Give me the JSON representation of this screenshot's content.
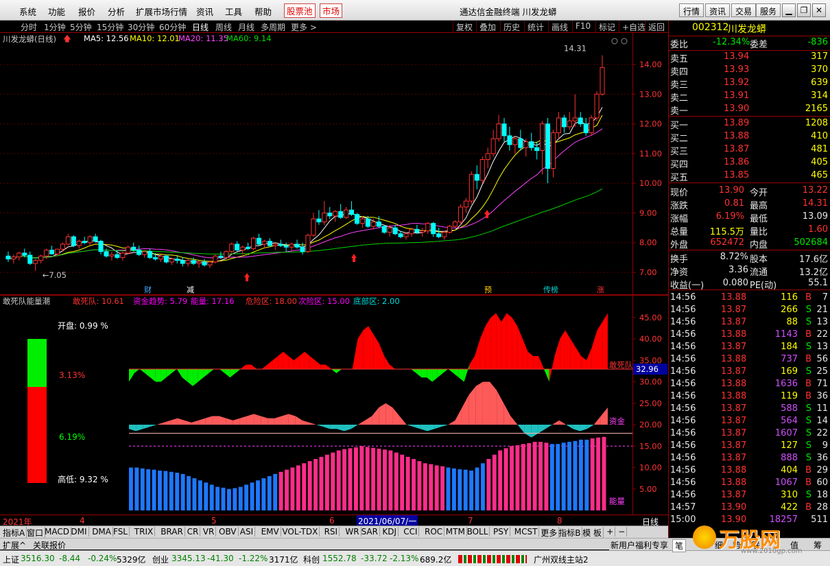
{
  "menubar": {
    "items": [
      "系统",
      "功能",
      "报价",
      "分析",
      "扩展市场行情",
      "资讯",
      "工具",
      "帮助"
    ],
    "highlight": [
      "股票池",
      "市场"
    ],
    "title": "通达信金融终端  川发龙蟒",
    "buttons": [
      "行情",
      "资讯",
      "交易",
      "服务"
    ]
  },
  "periods": [
    "分时",
    "1分钟",
    "5分钟",
    "15分钟",
    "30分钟",
    "60分钟",
    "日线",
    "周线",
    "月线",
    "多周期",
    "更多 >"
  ],
  "tools": [
    "复权",
    "叠加",
    "历史",
    "统计",
    "画线",
    "F10",
    "标记",
    "+自选",
    "返回"
  ],
  "chartinfo": {
    "name": "川发龙蟒(日线)",
    "ma5": "MA5: 12.56",
    "ma10": "MA10: 12.01",
    "ma20": "MA20: 11.35",
    "ma60": "MA60: 9.14"
  },
  "chart_data": {
    "type": "candlestick",
    "y_ticks": [
      "14.00",
      "13.00",
      "12.00",
      "11.00",
      "10.00",
      "9.00",
      "8.00",
      "7.00"
    ],
    "ylim": [
      6.7,
      14.6
    ],
    "annotations": {
      "high": "14.31",
      "low": "7.05"
    },
    "candles": [
      [
        7.55,
        7.7,
        7.35,
        7.45
      ],
      [
        7.45,
        7.6,
        7.3,
        7.52
      ],
      [
        7.52,
        7.7,
        7.4,
        7.65
      ],
      [
        7.65,
        7.8,
        7.5,
        7.58
      ],
      [
        7.58,
        7.7,
        7.25,
        7.3
      ],
      [
        7.3,
        7.45,
        7.05,
        7.4
      ],
      [
        7.4,
        7.6,
        7.3,
        7.55
      ],
      [
        7.55,
        7.8,
        7.45,
        7.75
      ],
      [
        7.75,
        7.9,
        7.6,
        7.62
      ],
      [
        7.62,
        7.8,
        7.55,
        7.78
      ],
      [
        7.78,
        8.0,
        7.7,
        7.95
      ],
      [
        7.95,
        8.3,
        7.9,
        8.2
      ],
      [
        8.2,
        8.25,
        7.85,
        7.9
      ],
      [
        7.9,
        8.1,
        7.8,
        8.05
      ],
      [
        8.05,
        8.2,
        7.95,
        8.0
      ],
      [
        8.0,
        8.25,
        7.9,
        8.2
      ],
      [
        8.2,
        8.3,
        8.0,
        8.05
      ],
      [
        8.05,
        8.1,
        7.6,
        7.7
      ],
      [
        7.7,
        7.8,
        7.5,
        7.55
      ],
      [
        7.55,
        7.7,
        7.4,
        7.6
      ],
      [
        7.6,
        7.75,
        7.45,
        7.5
      ],
      [
        7.5,
        7.7,
        7.4,
        7.65
      ],
      [
        7.65,
        7.9,
        7.6,
        7.85
      ],
      [
        7.85,
        8.0,
        7.7,
        7.75
      ],
      [
        7.75,
        7.9,
        7.55,
        7.6
      ],
      [
        7.6,
        7.75,
        7.5,
        7.7
      ],
      [
        7.7,
        7.8,
        7.45,
        7.5
      ],
      [
        7.5,
        7.65,
        7.4,
        7.45
      ],
      [
        7.45,
        7.6,
        7.35,
        7.55
      ],
      [
        7.55,
        7.6,
        7.3,
        7.35
      ],
      [
        7.35,
        7.5,
        7.25,
        7.45
      ],
      [
        7.45,
        7.55,
        7.3,
        7.4
      ],
      [
        7.4,
        7.5,
        7.2,
        7.3
      ],
      [
        7.3,
        7.45,
        7.2,
        7.4
      ],
      [
        7.4,
        7.5,
        7.25,
        7.3
      ],
      [
        7.3,
        7.4,
        7.15,
        7.35
      ],
      [
        7.35,
        7.45,
        7.2,
        7.25
      ],
      [
        7.25,
        7.4,
        7.15,
        7.35
      ],
      [
        7.35,
        7.6,
        7.3,
        7.55
      ],
      [
        7.55,
        7.7,
        7.45,
        7.5
      ],
      [
        7.5,
        7.75,
        7.45,
        7.7
      ],
      [
        7.7,
        8.0,
        7.65,
        7.95
      ],
      [
        7.95,
        8.05,
        7.7,
        7.75
      ],
      [
        7.75,
        7.9,
        7.6,
        7.85
      ],
      [
        7.85,
        8.0,
        7.75,
        7.8
      ],
      [
        7.8,
        8.2,
        7.75,
        8.15
      ],
      [
        8.15,
        8.3,
        7.9,
        7.95
      ],
      [
        7.95,
        8.1,
        7.8,
        8.05
      ],
      [
        8.05,
        8.15,
        7.85,
        7.9
      ],
      [
        7.9,
        8.0,
        7.75,
        7.95
      ],
      [
        7.95,
        8.1,
        7.85,
        7.9
      ],
      [
        7.9,
        8.0,
        7.7,
        7.85
      ],
      [
        7.85,
        8.0,
        7.75,
        7.95
      ],
      [
        7.95,
        8.1,
        7.8,
        7.85
      ],
      [
        7.85,
        8.0,
        7.6,
        7.7
      ],
      [
        7.7,
        8.3,
        7.65,
        8.25
      ],
      [
        8.25,
        9.0,
        8.2,
        8.8
      ],
      [
        8.8,
        9.1,
        8.6,
        8.7
      ],
      [
        8.7,
        9.4,
        8.6,
        9.0
      ],
      [
        9.0,
        9.2,
        8.8,
        8.9
      ],
      [
        8.9,
        9.1,
        8.7,
        9.05
      ],
      [
        9.05,
        9.3,
        8.8,
        8.85
      ],
      [
        8.85,
        9.2,
        8.8,
        9.1
      ],
      [
        9.1,
        9.4,
        8.9,
        8.95
      ],
      [
        8.95,
        9.0,
        8.6,
        8.65
      ],
      [
        8.65,
        8.9,
        8.5,
        8.8
      ],
      [
        8.8,
        8.9,
        8.5,
        8.55
      ],
      [
        8.55,
        8.8,
        8.45,
        8.7
      ],
      [
        8.7,
        8.9,
        8.5,
        8.55
      ],
      [
        8.55,
        8.6,
        8.3,
        8.35
      ],
      [
        8.35,
        8.6,
        8.2,
        8.5
      ],
      [
        8.5,
        8.6,
        8.25,
        8.3
      ],
      [
        8.3,
        8.4,
        8.15,
        8.2
      ],
      [
        8.2,
        8.35,
        8.1,
        8.3
      ],
      [
        8.3,
        8.5,
        8.2,
        8.45
      ],
      [
        8.45,
        8.6,
        8.3,
        8.35
      ],
      [
        8.35,
        8.5,
        8.2,
        8.4
      ],
      [
        8.4,
        8.7,
        8.3,
        8.65
      ],
      [
        8.65,
        8.7,
        8.2,
        8.3
      ],
      [
        8.3,
        8.5,
        8.15,
        8.2
      ],
      [
        8.2,
        8.4,
        8.1,
        8.35
      ],
      [
        8.35,
        8.6,
        8.3,
        8.55
      ],
      [
        8.55,
        8.75,
        8.5,
        8.7
      ],
      [
        8.7,
        9.3,
        8.6,
        9.2
      ],
      [
        9.2,
        9.5,
        9.0,
        9.4
      ],
      [
        9.4,
        10.4,
        9.3,
        10.3
      ],
      [
        10.3,
        10.6,
        9.8,
        10.1
      ],
      [
        10.1,
        10.9,
        10.0,
        10.8
      ],
      [
        10.8,
        11.2,
        10.5,
        11.0
      ],
      [
        11.0,
        11.8,
        10.9,
        11.5
      ],
      [
        11.5,
        12.3,
        11.4,
        12.0
      ],
      [
        12.0,
        12.2,
        11.4,
        11.6
      ],
      [
        11.6,
        11.9,
        11.1,
        11.3
      ],
      [
        11.3,
        11.6,
        11.0,
        11.5
      ],
      [
        11.5,
        11.8,
        11.1,
        11.2
      ],
      [
        11.2,
        11.5,
        10.9,
        11.4
      ],
      [
        11.4,
        11.7,
        11.1,
        11.2
      ],
      [
        11.2,
        11.4,
        10.8,
        11.1
      ],
      [
        11.1,
        12.1,
        10.3,
        12.0
      ],
      [
        12.0,
        12.2,
        10.0,
        10.5
      ],
      [
        10.5,
        11.8,
        10.2,
        11.7
      ],
      [
        11.7,
        12.4,
        11.5,
        12.2
      ],
      [
        12.2,
        12.3,
        11.7,
        11.9
      ],
      [
        11.9,
        12.4,
        11.8,
        12.1
      ],
      [
        12.1,
        13.0,
        11.9,
        12.2
      ],
      [
        12.2,
        12.4,
        11.9,
        12.0
      ],
      [
        12.0,
        12.2,
        11.6,
        11.7
      ],
      [
        11.7,
        12.3,
        11.6,
        12.2
      ],
      [
        12.2,
        13.1,
        12.1,
        13.0
      ],
      [
        13.0,
        14.31,
        12.95,
        13.9
      ]
    ],
    "ma_series": [
      {
        "name": "MA5",
        "color": "#ffffff"
      },
      {
        "name": "MA10",
        "color": "#ffff00"
      },
      {
        "name": "MA20",
        "color": "#ff40ff"
      },
      {
        "name": "MA60",
        "color": "#00d200"
      }
    ],
    "markers": [
      "财",
      "减",
      "预",
      "传榜",
      "涨"
    ]
  },
  "indic": {
    "title": "敢死队能量潮",
    "g1": "敢死队: 10.61",
    "g2": "资金趋势: 5.79",
    "g3": "能量: 17.16",
    "g4": "危险区: 18.00",
    "g5": "次险区: 15.00",
    "g6": "底部区: 2.00",
    "y_ticks": [
      "45.00",
      "40.00",
      "35.00",
      "30.00",
      "25.00",
      "20.00",
      "15.00",
      "10.00",
      "5.00"
    ],
    "tag1": "敢死队",
    "tag_val": "32.96",
    "tag2": "资金",
    "tag3": "能量",
    "info_open": "开盘:  0.99 %",
    "info_mid1": "3.13%",
    "info_mid2": "6.19%",
    "info_low": "高低:  9.32 %"
  },
  "dates": [
    "2021年",
    "4",
    "5",
    "6",
    "2021/06/07/一",
    "7",
    "8"
  ],
  "dates_right": "日线",
  "tabs": [
    "指标A",
    "窗口",
    "MACD",
    "DMI",
    "DMA",
    "FSL",
    "TRIX",
    "BRAR",
    "CR",
    "VR",
    "OBV",
    "ASI",
    "EMV",
    "VOL-TDX",
    "RSI",
    "WR",
    "SAR",
    "KDJ",
    "CCI",
    "ROC",
    "MTM",
    "BOLL",
    "PSY",
    "MCST",
    "更多",
    "指标B",
    "模 板",
    "+",
    "−"
  ],
  "tabs2": [
    "扩展^",
    "关联报价"
  ],
  "quote": {
    "code": "002312",
    "name": "川发龙蟒",
    "weibi_l": "委比",
    "weibi": "-12.34%",
    "weicha_l": "委差",
    "weicha": "-836",
    "asks": [
      [
        "卖五",
        "13.94",
        "317"
      ],
      [
        "卖四",
        "13.93",
        "370"
      ],
      [
        "卖三",
        "13.92",
        "639"
      ],
      [
        "卖二",
        "13.91",
        "314"
      ],
      [
        "卖一",
        "13.90",
        "2165"
      ]
    ],
    "bids": [
      [
        "买一",
        "13.89",
        "1208"
      ],
      [
        "买二",
        "13.88",
        "410"
      ],
      [
        "买三",
        "13.87",
        "481"
      ],
      [
        "买四",
        "13.86",
        "405"
      ],
      [
        "买五",
        "13.85",
        "465"
      ]
    ],
    "stats": [
      [
        "现价",
        "13.90",
        "今开",
        "13.22"
      ],
      [
        "涨跌",
        "0.81",
        "最高",
        "14.31"
      ],
      [
        "涨幅",
        "6.19%",
        "最低",
        "13.09"
      ],
      [
        "总量",
        "115.5万",
        "量比",
        "1.60"
      ],
      [
        "外盘",
        "652472",
        "内盘",
        "502684"
      ]
    ],
    "stats2": [
      [
        "换手",
        "8.72%",
        "股本",
        "17.6亿"
      ],
      [
        "净资",
        "3.36",
        "流通",
        "13.2亿"
      ],
      [
        "收益(一)",
        "0.080",
        "PE(动)",
        "55.1"
      ]
    ],
    "ticks": [
      [
        "14:56",
        "13.88",
        "116",
        "B",
        "7"
      ],
      [
        "14:56",
        "13.87",
        "266",
        "S",
        "21"
      ],
      [
        "14:56",
        "13.87",
        "88",
        "S",
        "13"
      ],
      [
        "14:56",
        "13.88",
        "1143",
        "B",
        "22"
      ],
      [
        "14:56",
        "13.87",
        "184",
        "S",
        "13"
      ],
      [
        "14:56",
        "13.88",
        "737",
        "B",
        "56"
      ],
      [
        "14:56",
        "13.87",
        "169",
        "S",
        "25"
      ],
      [
        "14:56",
        "13.88",
        "1636",
        "B",
        "71"
      ],
      [
        "14:56",
        "13.88",
        "119",
        "B",
        "36"
      ],
      [
        "14:56",
        "13.87",
        "588",
        "S",
        "11"
      ],
      [
        "14:56",
        "13.87",
        "564",
        "S",
        "14"
      ],
      [
        "14:56",
        "13.87",
        "1607",
        "S",
        "22"
      ],
      [
        "14:56",
        "13.87",
        "127",
        "S",
        "9"
      ],
      [
        "14:56",
        "13.87",
        "888",
        "S",
        "36"
      ],
      [
        "14:56",
        "13.88",
        "404",
        "B",
        "29"
      ],
      [
        "14:56",
        "13.88",
        "1067",
        "B",
        "60"
      ],
      [
        "14:56",
        "13.87",
        "310",
        "S",
        "18"
      ],
      [
        "14:57",
        "13.90",
        "422",
        "B",
        "28"
      ],
      [
        "15:00",
        "13.90",
        "18257",
        "",
        "511"
      ]
    ]
  },
  "status": {
    "sh_l": "上证",
    "sh": "3516.30",
    "sh_c": "-8.44",
    "sh_p": "-0.24%",
    "sh_v": "5329亿",
    "cy_l": "创业",
    "cy": "3345.13",
    "cy_c": "-41.30",
    "cy_p": "-1.22%",
    "cy_v": "3171亿",
    "kc_l": "科创",
    "kc": "1552.78",
    "kc_c": "-33.72",
    "kc_p": "-2.13%",
    "kc_v": "689.2亿",
    "server": "广州双线主站2",
    "promo": "新用户福利专享",
    "logo": "万股网",
    "logo_sub": "www.2010gp.com",
    "rtabs": [
      "笔",
      "细",
      "势",
      "联",
      "值",
      "筹"
    ]
  },
  "colors": {
    "up": "#ff3232",
    "down": "#00ffff",
    "bg": "#000000",
    "grid": "#8b0000"
  }
}
